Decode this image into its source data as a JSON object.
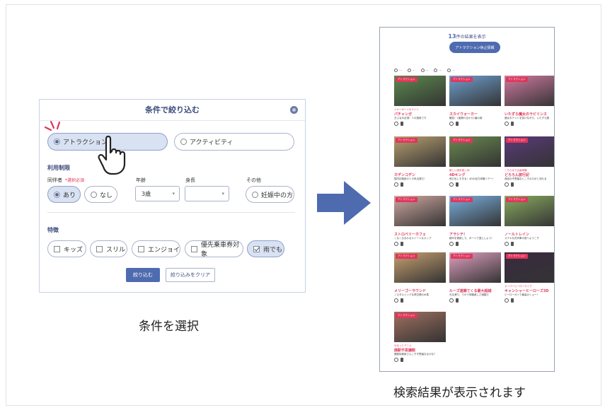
{
  "filter_panel": {
    "title": "条件で絞り込む",
    "type_options": [
      {
        "label": "アトラクション",
        "selected": true
      },
      {
        "label": "アクティビティ",
        "selected": false
      }
    ],
    "usage_section": "利用制限",
    "companion_label": "同伴者",
    "companion_required": "*選択必須",
    "companion_options": [
      {
        "label": "あり",
        "selected": true
      },
      {
        "label": "なし",
        "selected": false
      }
    ],
    "age_label": "年齢",
    "age_value": "3歳",
    "height_label": "身長",
    "height_value": "",
    "other_label": "その他",
    "other_option": "妊娠中の方",
    "feature_section": "特徴",
    "features": [
      {
        "label": "キッズ",
        "checked": false
      },
      {
        "label": "スリル",
        "checked": false
      },
      {
        "label": "エンジョイ",
        "checked": false
      },
      {
        "label": "優先乗車券対象",
        "checked": false
      },
      {
        "label": "雨でも",
        "checked": true
      }
    ],
    "apply_button": "絞り込む",
    "clear_button": "絞り込みをクリア"
  },
  "caption_left": "条件を選択",
  "caption_right": "検索結果が表示されます",
  "result_screen": {
    "count": "13",
    "count_suffix": "件の結果を表示",
    "pill_label": "アトラクション休止情報",
    "cards": [
      {
        "tag": "アトラクション",
        "sub": "イヤーボーイのライド",
        "title": "パチャンガ",
        "desc": "ぎぶるみ必須！１の施設です",
        "color": "#5c8a4e"
      },
      {
        "tag": "アトラクション",
        "sub": "",
        "title": "スカイウォーカー",
        "desc": "観覧！1度乗れるから1番の楽",
        "color": "#6f9fd0"
      },
      {
        "tag": "アトラクション",
        "sub": "",
        "title": "いたずら魔女のラビリンス",
        "desc": "魔女おテントを抜けながら、いたずら魔",
        "color": "#d07aa0"
      },
      {
        "tag": "アトラクション",
        "sub": "",
        "title": "カデンコデン",
        "desc": "国内初施設のトロ系出発だ！",
        "color": "#b8a070"
      },
      {
        "tag": "アトラクション",
        "sub": "新しい謎を楽しみ！",
        "title": "4Dキング",
        "desc": "飛び出しすぎる！4Dの迫力体験ツアー！",
        "color": "#6a8a50"
      },
      {
        "tag": "アトラクション",
        "sub": "こちらまで企画体験",
        "title": "どろろん旅行記",
        "desc": "昔話の不思議なところのロボと流れる",
        "color": "#5a3a7a"
      },
      {
        "tag": "アトラクション",
        "sub": "",
        "title": "ストロベリーカフェ",
        "desc": "くるくるまわるスイートなカップ",
        "color": "#d0a8a0"
      },
      {
        "tag": "アトラクション",
        "sub": "",
        "title": "アラシテ！",
        "desc": "絶叫を乗越しで、ボーンで頂上しよう！",
        "color": "#7ab0e0"
      },
      {
        "tag": "アトラクション",
        "sub": "",
        "title": "ノールトレイン",
        "desc": "ステキな花列車の旅へようこそ",
        "color": "#8aaa60"
      },
      {
        "tag": "アトラクション",
        "sub": "",
        "title": "メリーゴーラウンド",
        "desc": "ノスタルジックな夢空間の木馬",
        "color": "#c8a070"
      },
      {
        "tag": "アトラクション",
        "sub": "",
        "title": "ルーズ連鎖てくる最大超越",
        "desc": "光る滑り、でかで体験楽しさ満載だ",
        "color": "#e0a0c0"
      },
      {
        "tag": "アトラクション",
        "sub": "スーパーヒーローライブ",
        "title": "キャンシャーヒーローズ3D",
        "desc": "ヒーローガイで最高のショー！",
        "color": "#3a2a40"
      },
      {
        "tag": "アトラクション",
        "sub": "ゆるっとアニメ",
        "title": "廃駅不思議館",
        "desc": "廃駅探検家さんこそ不思議なるかな？",
        "color": "#a07060"
      }
    ]
  }
}
